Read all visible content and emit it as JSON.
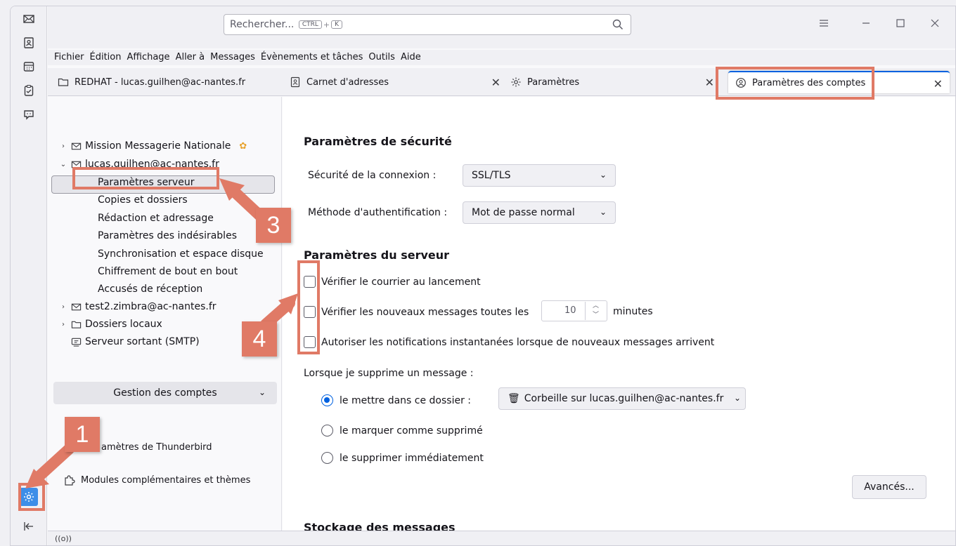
{
  "search": {
    "placeholder": "Rechercher...",
    "kbd1": "CTRL",
    "kbd2": "K"
  },
  "menu": [
    "Fichier",
    "Édition",
    "Affichage",
    "Aller à",
    "Messages",
    "Évènements et tâches",
    "Outils",
    "Aide"
  ],
  "tabs": [
    {
      "label": "REDHAT - lucas.guilhen@ac-nantes.fr"
    },
    {
      "label": "Carnet d'adresses"
    },
    {
      "label": "Paramètres"
    },
    {
      "label": "Paramètres des comptes"
    }
  ],
  "tree": {
    "account1": "Mission Messagerie Nationale",
    "account2": "lucas.guilhen@ac-nantes.fr",
    "children": [
      "Paramètres serveur",
      "Copies et dossiers",
      "Rédaction et adressage",
      "Paramètres des indésirables",
      "Synchronisation et espace disque",
      "Chiffrement de bout en bout",
      "Accusés de réception"
    ],
    "account3": "test2.zimbra@ac-nantes.fr",
    "local": "Dossiers locaux",
    "smtp": "Serveur sortant (SMTP)"
  },
  "manage_accounts": "Gestion des comptes",
  "thunderbird_settings": "amètres de Thunderbird",
  "addons": "Modules complémentaires et thèmes",
  "security": {
    "title": "Paramètres de sécurité",
    "conn_label": "Sécurité de la connexion :",
    "conn_value": "SSL/TLS",
    "auth_label": "Méthode d'authentification :",
    "auth_value": "Mot de passe normal"
  },
  "server": {
    "title": "Paramètres du serveur",
    "check_startup": "Vérifier le courrier au lancement",
    "check_every": "Vérifier les nouveaux messages toutes les",
    "interval": "10",
    "minutes": "minutes",
    "push": "Autoriser les notifications instantanées lorsque de nouveaux messages arrivent",
    "delete_label": "Lorsque je supprime un message :",
    "opt_move": "le mettre dans ce dossier :",
    "folder": "Corbeille sur lucas.guilhen@ac-nantes.fr",
    "opt_mark": "le marquer comme supprimé",
    "opt_delete": "le supprimer immédiatement",
    "advanced": "Avancés...",
    "storage_title": "Stockage des messages"
  },
  "status": "((o))",
  "annotations": [
    "1",
    "3",
    "4"
  ],
  "colors": {
    "annotation": "#e07a66",
    "accent": "#0061e0"
  }
}
